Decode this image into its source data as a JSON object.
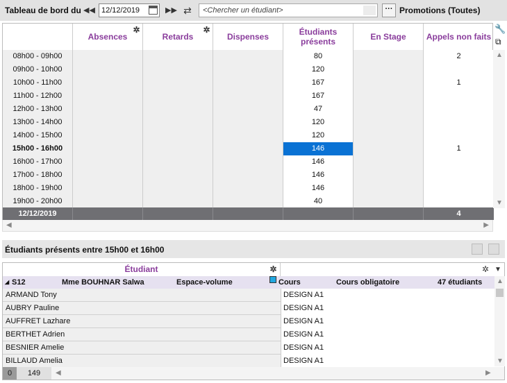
{
  "toolbar": {
    "title": "Tableau de bord du",
    "date": "12/12/2019",
    "search_placeholder": "<Chercher un étudiant>",
    "more": "···",
    "promotions": "Promotions (Toutes)"
  },
  "grid": {
    "columns": [
      "Absences",
      "Retards",
      "Dispenses",
      "Étudiants présents",
      "En Stage",
      "Appels non faits"
    ],
    "rows": [
      {
        "time": "08h00 - 09h00",
        "present": "80",
        "appels": "2"
      },
      {
        "time": "09h00 - 10h00",
        "present": "120",
        "appels": ""
      },
      {
        "time": "10h00 - 11h00",
        "present": "167",
        "appels": "1"
      },
      {
        "time": "11h00 - 12h00",
        "present": "167",
        "appels": ""
      },
      {
        "time": "12h00 - 13h00",
        "present": "47",
        "appels": ""
      },
      {
        "time": "13h00 - 14h00",
        "present": "120",
        "appels": ""
      },
      {
        "time": "14h00 - 15h00",
        "present": "120",
        "appels": ""
      },
      {
        "time": "15h00 - 16h00",
        "present": "146",
        "appels": "1"
      },
      {
        "time": "16h00 - 17h00",
        "present": "146",
        "appels": ""
      },
      {
        "time": "17h00 - 18h00",
        "present": "146",
        "appels": ""
      },
      {
        "time": "18h00 - 19h00",
        "present": "146",
        "appels": ""
      },
      {
        "time": "19h00 - 20h00",
        "present": "40",
        "appels": ""
      }
    ],
    "total": {
      "label": "12/12/2019",
      "appels": "4"
    }
  },
  "section": {
    "title": "Étudiants présents entre 15h00 et 16h00"
  },
  "list": {
    "header": "Étudiant",
    "group": {
      "name": "S12",
      "teacher": "Mme BOUHNAR Salwa",
      "room": "Espace-volume",
      "type": "Cours",
      "kind": "Cours obligatoire",
      "count": "47 étudiants"
    },
    "students": [
      {
        "name": "ARMAND Tony",
        "group": "DESIGN A1"
      },
      {
        "name": "AUBRY Pauline",
        "group": "DESIGN A1"
      },
      {
        "name": "AUFFRET Lazhare",
        "group": "DESIGN A1"
      },
      {
        "name": "BERTHET Adrien",
        "group": "DESIGN A1"
      },
      {
        "name": "BESNIER Amelie",
        "group": "DESIGN A1"
      },
      {
        "name": "BILLAUD Amelia",
        "group": "DESIGN A1"
      }
    ],
    "footer": {
      "selected": "0",
      "total": "149"
    }
  }
}
